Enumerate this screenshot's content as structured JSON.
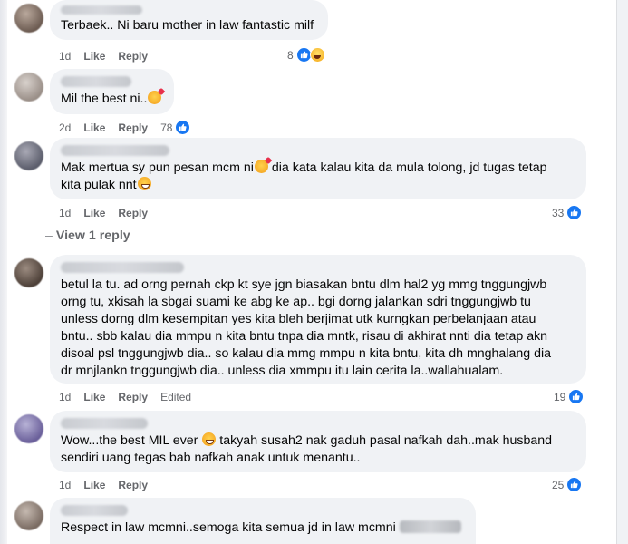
{
  "comments": [
    {
      "text": "Terbaek.. Ni baru mother in law fantastic milf",
      "time": "1d",
      "like_label": "Like",
      "reply_label": "Reply",
      "reaction_count": "8",
      "reactions": [
        "like-icon",
        "haha-icon"
      ]
    },
    {
      "text": "Mil the best ni..",
      "emoji_after": "smiling-hearts-emoji",
      "time": "2d",
      "like_label": "Like",
      "reply_label": "Reply",
      "reaction_count": "78",
      "reactions": [
        "like-icon"
      ]
    },
    {
      "text_part1": "Mak mertua sy pun pesan mcm ni",
      "text_part2": " dia kata kalau kita da mula tolong, jd tugas tetap\nkita pulak nnt",
      "emojis": [
        "smiling-hearts-emoji",
        "grinning-emoji"
      ],
      "time": "1d",
      "like_label": "Like",
      "reply_label": "Reply",
      "reaction_count": "33",
      "reactions": [
        "like-icon"
      ],
      "view_replies": "View 1 reply"
    },
    {
      "text": "betul la tu. ad orng pernah ckp kt sye jgn biasakan bntu dlm hal2 yg mmg tnggungjwb\norng tu, xkisah la sbgai suami ke abg ke ap.. bgi dorng jalankan sdri tnggungjwb tu\nunless dorng dlm kesempitan yes kita bleh berjimat utk kurngkan perbelanjaan atau\nbntu.. sbb kalau dia mmpu n kita bntu tnpa dia mntk, risau di akhirat nnti dia tetap akn\ndisoal psl tnggungjwb dia.. so kalau dia mmg mmpu n kita bntu, kita dh mnghalang dia\ndr mnjlankn tnggungjwb dia.. unless dia xmmpu itu lain cerita la..wallahualam.",
      "time": "1d",
      "like_label": "Like",
      "reply_label": "Reply",
      "edited_label": "Edited",
      "reaction_count": "19",
      "reactions": [
        "like-icon"
      ]
    },
    {
      "text_part1": "Wow...the best MIL ever ",
      "text_part2": " takyah susah2 nak gaduh pasal nafkah dah..mak husband\nsendiri uang tegas bab nafkah anak untuk menantu..",
      "emojis": [
        "grinning-emoji"
      ],
      "time": "1d",
      "like_label": "Like",
      "reply_label": "Reply",
      "reaction_count": "25",
      "reactions": [
        "like-icon"
      ]
    },
    {
      "text": "Respect in law mcmni..semoga kita semua jd in law mcmni"
    }
  ],
  "colors": {
    "bubble": "#f0f2f5",
    "meta": "#65676b",
    "like_blue": "#1877f2",
    "text": "#050505"
  }
}
